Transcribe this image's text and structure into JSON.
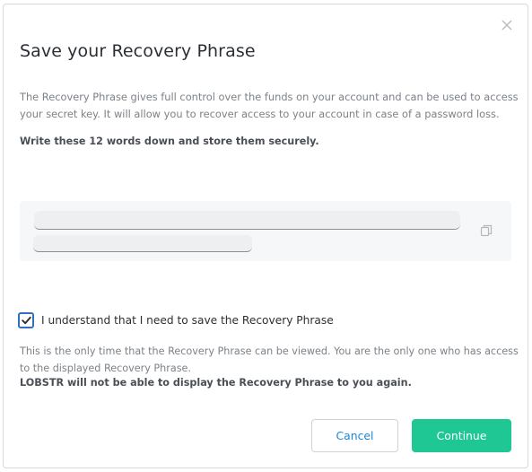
{
  "modal": {
    "title": "Save your Recovery Phrase",
    "description": "The Recovery Phrase gives full control over the funds on your account and can be used to access your secret key. It will allow you to recover access to your account in case of a password loss.",
    "instruction": "Write these 12 words down and store them securely."
  },
  "phrase": {
    "copy_icon": "copy-icon"
  },
  "confirm": {
    "checked": true,
    "label": "I understand that I need to save the Recovery Phrase"
  },
  "note": {
    "text": "This is the only time that the Recovery Phrase can be viewed. You are the only one who has access to the displayed Recovery Phrase.",
    "bold": "LOBSTR will not be able to display the Recovery Phrase to you again."
  },
  "buttons": {
    "cancel_label": "Cancel",
    "continue_label": "Continue"
  },
  "colors": {
    "accent_green": "#1fc795",
    "link_blue": "#1b87d8",
    "checkbox_blue": "#2f6fc4"
  }
}
